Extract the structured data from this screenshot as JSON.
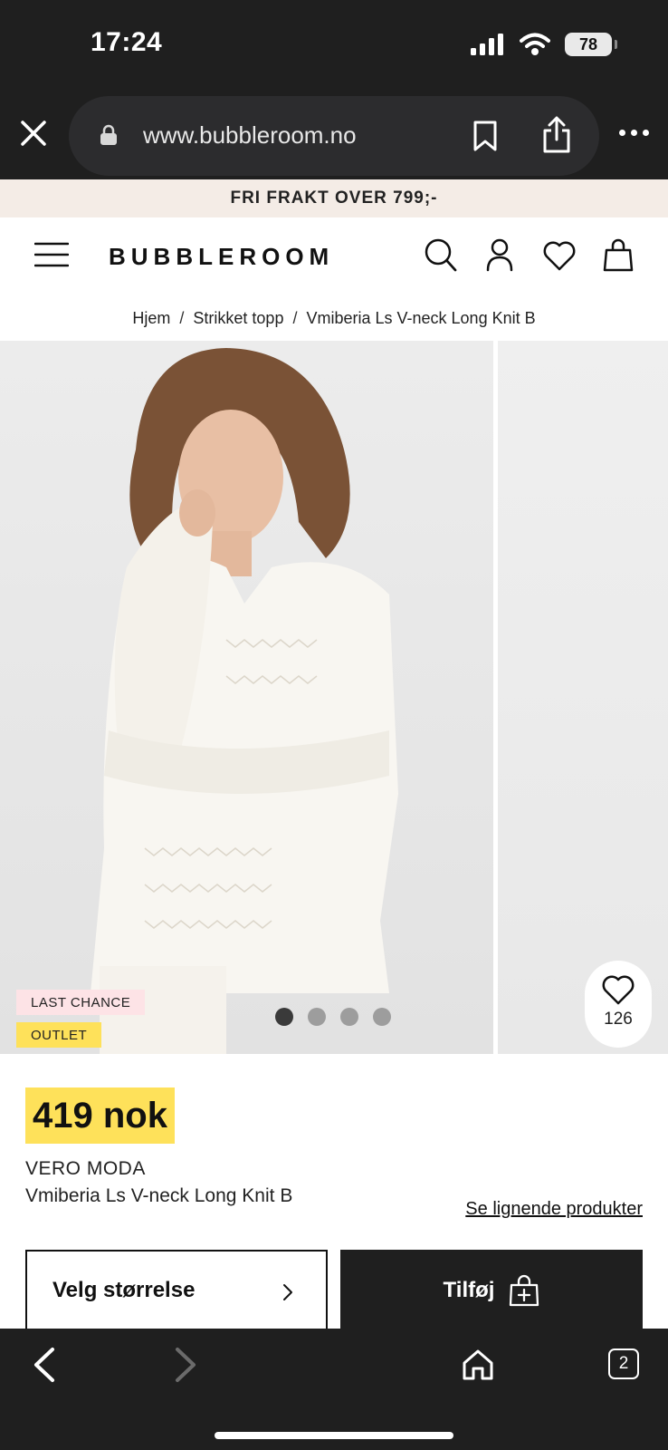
{
  "status_bar": {
    "time": "17:24",
    "battery": "78"
  },
  "browser": {
    "url": "www.bubbleroom.no",
    "tab_count": "2"
  },
  "promo": {
    "text": "FRI FRAKT OVER 799;-"
  },
  "header": {
    "logo": "BUBBLEROOM"
  },
  "breadcrumb": {
    "items": [
      "Hjem",
      "Strikket topp",
      "Vmiberia Ls V-neck Long Knit B"
    ],
    "separator": "/"
  },
  "gallery": {
    "badges": [
      "LAST CHANCE",
      "OUTLET"
    ],
    "slide_count": 4,
    "active_slide": 1,
    "wishlist_count": "126",
    "colors": {
      "badge_last_chance_bg": "#fde3e6",
      "badge_outlet_bg": "#fee15a"
    }
  },
  "product": {
    "price": "419 nok",
    "brand": "VERO MODA",
    "name": "Vmiberia Ls V-neck Long Knit B",
    "similar_link": "Se lignende produkter",
    "size_select_label": "Velg størrelse",
    "add_button_label": "Tilføj",
    "colors": {
      "price_highlight": "#fee15a",
      "add_button_bg": "#1f1f1f"
    }
  }
}
